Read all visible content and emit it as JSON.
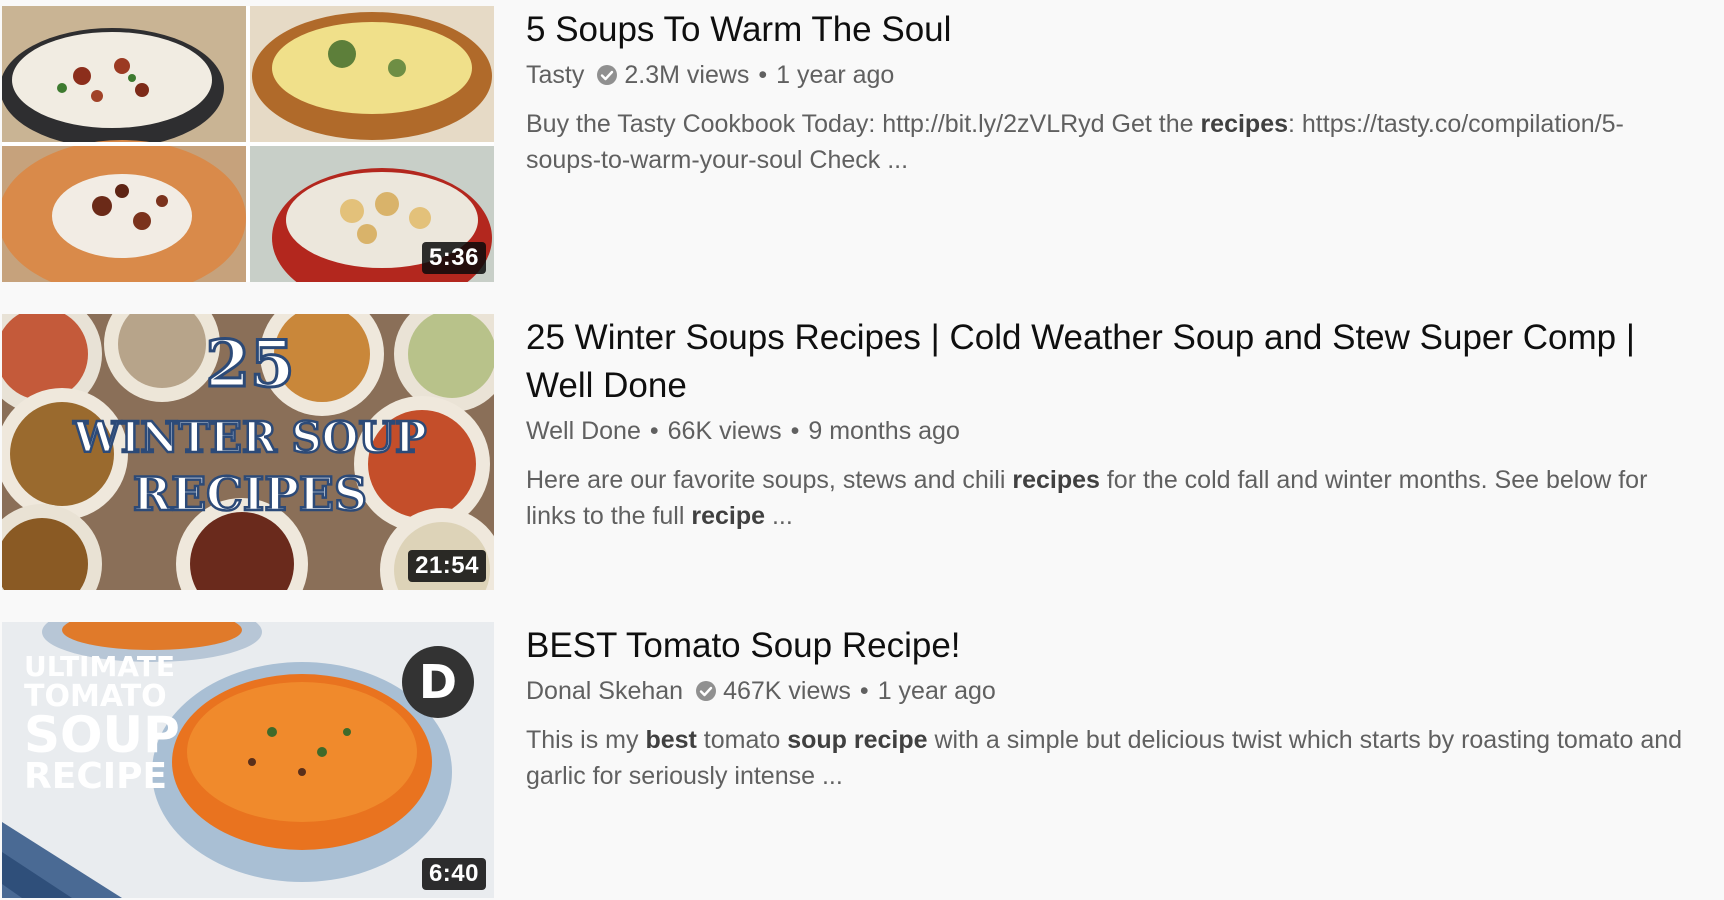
{
  "results": [
    {
      "title": "5 Soups To Warm The Soul",
      "channel": "Tasty",
      "verified": true,
      "views": "2.3M views",
      "age": "1 year ago",
      "duration": "5:36",
      "description": [
        {
          "text": "Buy the Tasty Cookbook Today: http://bit.ly/2zVLRyd Get the ",
          "bold": false
        },
        {
          "text": "recipes",
          "bold": true
        },
        {
          "text": ": https://tasty.co/compilation/5-soups-to-warm-your-soul Check ...",
          "bold": false
        }
      ]
    },
    {
      "title": "25 Winter Soups Recipes | Cold Weather Soup and Stew Super Comp | Well Done",
      "channel": "Well Done",
      "verified": false,
      "views": "66K views",
      "age": "9 months ago",
      "duration": "21:54",
      "thumbnail_text": [
        "25",
        "WINTER SOUP",
        "RECIPES"
      ],
      "description": [
        {
          "text": "Here are our favorite soups, stews and chili ",
          "bold": false
        },
        {
          "text": "recipes",
          "bold": true
        },
        {
          "text": " for the cold fall and winter months. See below for links to the full ",
          "bold": false
        },
        {
          "text": "recipe",
          "bold": true
        },
        {
          "text": " ...",
          "bold": false
        }
      ]
    },
    {
      "title": "BEST Tomato Soup Recipe!",
      "channel": "Donal Skehan",
      "verified": true,
      "views": "467K views",
      "age": "1 year ago",
      "duration": "6:40",
      "thumbnail_text": [
        "ULTIMATE",
        "TOMATO",
        "SOUP",
        "RECIPE",
        "D"
      ],
      "description": [
        {
          "text": "This is my ",
          "bold": false
        },
        {
          "text": "best",
          "bold": true
        },
        {
          "text": " tomato ",
          "bold": false
        },
        {
          "text": "soup",
          "bold": true
        },
        {
          "text": " ",
          "bold": false
        },
        {
          "text": "recipe",
          "bold": true
        },
        {
          "text": " with a simple but delicious twist which starts by roasting tomato and garlic for seriously intense ...",
          "bold": false
        }
      ]
    }
  ],
  "separator": "•",
  "icons": {
    "verified": "verified-check-icon"
  },
  "colors": {
    "background": "#f9f9f9",
    "title": "#0f0f0f",
    "meta": "#606060"
  }
}
